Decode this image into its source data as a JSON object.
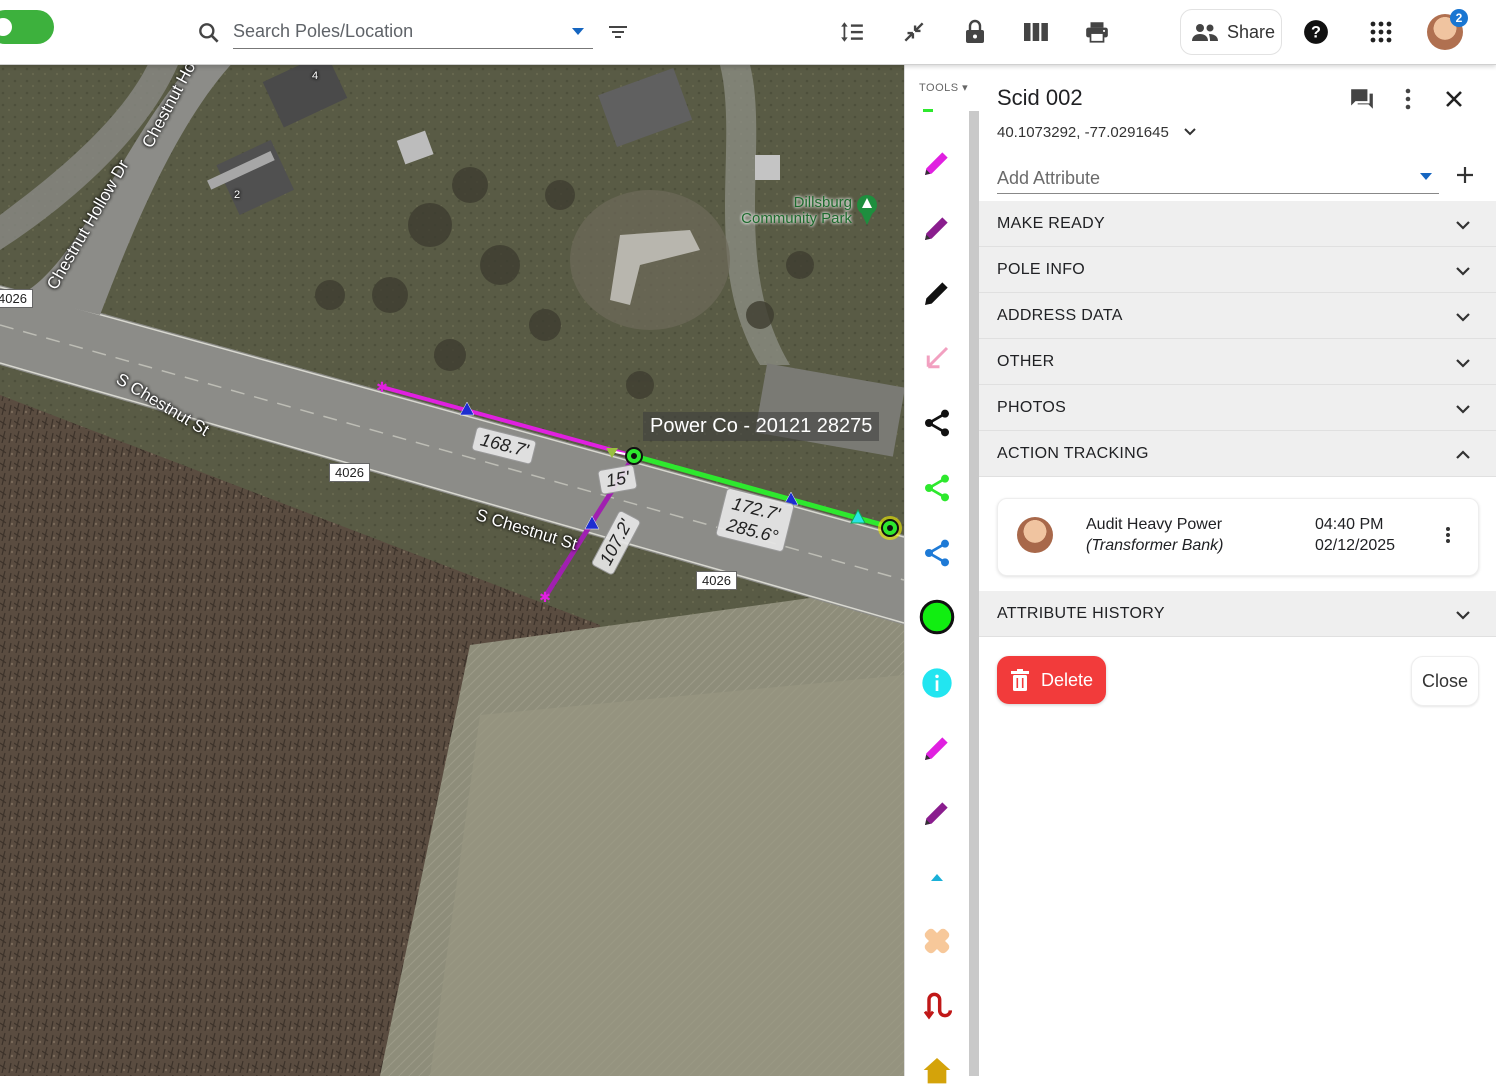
{
  "topbar": {
    "search_placeholder": "Search Poles/Location",
    "share_label": "Share",
    "notification_count": "2",
    "icons": [
      "filter-icon",
      "sort-lines-icon",
      "collapse-arrows-icon",
      "lock-icon",
      "columns-icon",
      "print-icon",
      "people-icon",
      "help-icon",
      "apps-grid-icon"
    ]
  },
  "map": {
    "street_labels": [
      "S Chestnut St",
      "S Chestnut St",
      "Chestnut Hollow Dr",
      "Chestnut Ho"
    ],
    "road_shields": [
      "4026",
      "4026",
      "4026"
    ],
    "place_label": "Dillsburg Community Park",
    "pole_label": "Power Co - 20121 28275",
    "measurements": [
      "168.7'",
      "15'",
      "107.2'",
      "172.7'",
      "285.6°"
    ],
    "house_numbers": [
      "4",
      "2"
    ],
    "colors": {
      "magenta_span": "#e020e0",
      "green_span": "#2ee82e",
      "purple_span": "#a020b0"
    }
  },
  "tools": {
    "label": "TOOLS",
    "items": [
      "magenta-pencil-icon",
      "purple-pencil-icon",
      "black-pencil-icon",
      "pink-arrow-icon",
      "black-share-icon",
      "green-share-icon",
      "blue-share-icon",
      "green-circle-icon",
      "info-icon",
      "magenta-pencil-icon",
      "purple-pencil-icon",
      "cyan-triangle-icon",
      "bandage-icon",
      "red-route-icon",
      "home-icon"
    ]
  },
  "panel": {
    "title": "Scid 002",
    "coordinates": "40.1073292, -77.0291645",
    "add_attribute_placeholder": "Add Attribute",
    "sections": [
      {
        "label": "MAKE READY",
        "expanded": false
      },
      {
        "label": "POLE INFO",
        "expanded": false
      },
      {
        "label": "ADDRESS DATA",
        "expanded": false
      },
      {
        "label": "OTHER",
        "expanded": false
      },
      {
        "label": "PHOTOS",
        "expanded": false
      },
      {
        "label": "ACTION TRACKING",
        "expanded": true
      },
      {
        "label": "ATTRIBUTE HISTORY",
        "expanded": false
      }
    ],
    "action": {
      "title": "Audit Heavy Power",
      "subtitle": "(Transformer Bank)",
      "time": "04:40 PM",
      "date": "02/12/2025"
    },
    "delete_label": "Delete",
    "close_label": "Close"
  }
}
